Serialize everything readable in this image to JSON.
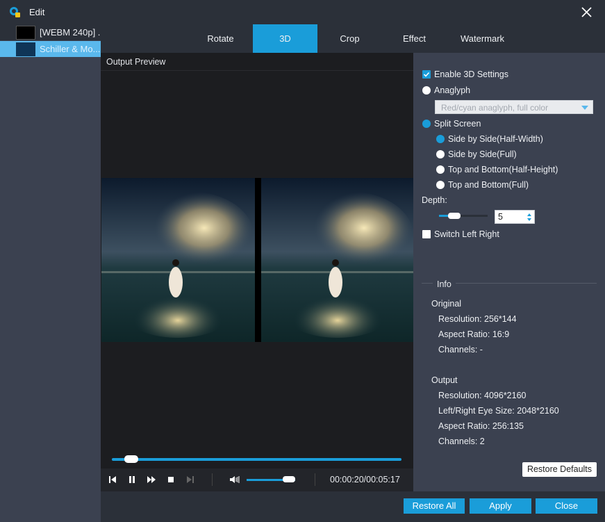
{
  "window": {
    "title": "Edit"
  },
  "files": [
    {
      "name": "[WEBM 240p] ..."
    },
    {
      "name": "Schiller & Mo..."
    }
  ],
  "tabs": [
    {
      "label": "Rotate"
    },
    {
      "label": "3D",
      "active": true
    },
    {
      "label": "Crop"
    },
    {
      "label": "Effect"
    },
    {
      "label": "Watermark"
    }
  ],
  "preview": {
    "label": "Output Preview",
    "timecode": "00:00:20/00:05:17",
    "seek_progress": 0.07,
    "volume_level": 0.85
  },
  "settings": {
    "enable_3d": {
      "label": "Enable 3D Settings",
      "checked": true
    },
    "anaglyph": {
      "label": "Anaglyph",
      "checked": false
    },
    "anaglyph_select": {
      "value": "Red/cyan anaglyph, full color"
    },
    "split_screen": {
      "label": "Split Screen",
      "checked": true
    },
    "split_options": [
      {
        "label": "Side by Side(Half-Width)",
        "checked": true
      },
      {
        "label": "Side by Side(Full)",
        "checked": false
      },
      {
        "label": "Top and Bottom(Half-Height)",
        "checked": false
      },
      {
        "label": "Top and Bottom(Full)",
        "checked": false
      }
    ],
    "depth": {
      "label": "Depth:",
      "value": "5"
    },
    "switch_lr": {
      "label": "Switch Left Right",
      "checked": false
    },
    "restore_defaults": "Restore Defaults"
  },
  "info": {
    "title": "Info",
    "original": {
      "heading": "Original",
      "resolution": "Resolution: 256*144",
      "aspect": "Aspect Ratio: 16:9",
      "channels": "Channels: -"
    },
    "output": {
      "heading": "Output",
      "resolution": "Resolution: 4096*2160",
      "eye_size": "Left/Right Eye Size: 2048*2160",
      "aspect": "Aspect Ratio: 256:135",
      "channels": "Channels: 2"
    }
  },
  "buttons": {
    "restore_all": "Restore All",
    "apply": "Apply",
    "close": "Close"
  },
  "colors": {
    "accent": "#1a9dd9",
    "panel": "#3b4150",
    "background": "#2b3039"
  }
}
